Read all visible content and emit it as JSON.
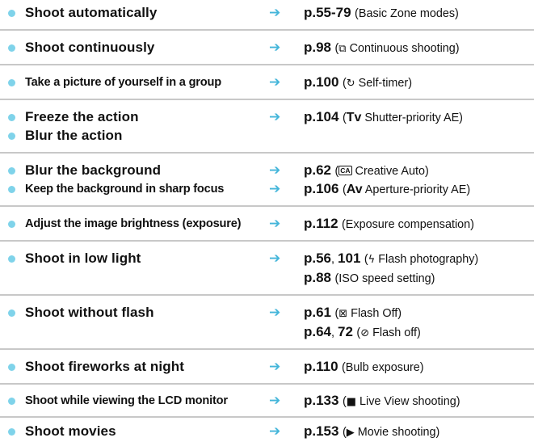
{
  "arrow_glyph": "➔",
  "colors": {
    "bullet": "#7fd3ea",
    "arrow": "#45b6da",
    "separator": "#c8c8c8"
  },
  "rows": [
    {
      "label": "Shoot automatically",
      "ref_pages": "p.55-79",
      "ref_note": "(Basic Zone modes)"
    },
    {
      "label": "Shoot continuously",
      "ref_pages": "p.98",
      "ref_open": "(",
      "ref_icon": "⧉",
      "ref_note": " Continuous shooting)"
    },
    {
      "label": "Take a picture of yourself in a group",
      "ref_pages": "p.100",
      "ref_open": "(",
      "ref_icon": "↻",
      "ref_note": " Self-timer)"
    },
    {
      "label": "Freeze the action",
      "ref_pages": "p.104",
      "ref_open": "(",
      "ref_abbr": "Tv",
      "ref_note": " Shutter-priority AE)"
    },
    {
      "label": "Blur the action"
    },
    {
      "label": "Blur the background",
      "ref_pages": "p.62",
      "ref_open": "(",
      "ref_boxicon": "CA",
      "ref_note": " Creative Auto)"
    },
    {
      "label": "Keep the background in sharp focus",
      "ref_pages": "p.106",
      "ref_open": "(",
      "ref_abbr": "Av",
      "ref_note": " Aperture-priority AE)"
    },
    {
      "label": "Adjust the image brightness (exposure)",
      "ref_pages": "p.112",
      "ref_note": "(Exposure compensation)"
    },
    {
      "label": "Shoot in low light",
      "ref_pages": "p.56",
      "ref_sep": ", ",
      "ref_pages2": "101",
      "ref_open": "(",
      "ref_icon": "ϟ",
      "ref_note": " Flash photography)"
    },
    {
      "ref_pages": "p.88",
      "ref_note": "(ISO speed setting)"
    },
    {
      "label": "Shoot without flash",
      "ref_pages": "p.61",
      "ref_open": "(",
      "ref_icon": "⊠",
      "ref_note": " Flash Off)"
    },
    {
      "ref_pages": "p.64",
      "ref_sep": ", ",
      "ref_pages2": "72",
      "ref_open": "(",
      "ref_icon": "⊘",
      "ref_note": " Flash off)"
    },
    {
      "label": "Shoot fireworks at night",
      "ref_pages": "p.110",
      "ref_note": "(Bulb exposure)"
    },
    {
      "label": "Shoot while viewing the LCD monitor",
      "ref_pages": "p.133",
      "ref_open": "(",
      "ref_icon": "■",
      "ref_note": " Live View shooting)"
    },
    {
      "label": "Shoot movies",
      "ref_pages": "p.153",
      "ref_open": "(",
      "ref_icon": "▶",
      "ref_note": " Movie shooting)"
    }
  ]
}
